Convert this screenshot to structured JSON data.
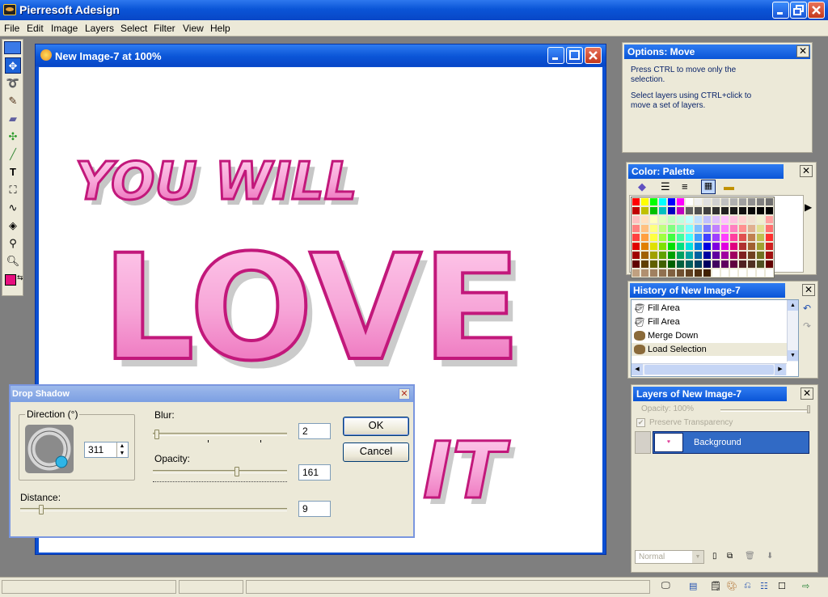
{
  "app": {
    "title": "Pierresoft Adesign"
  },
  "menu": [
    "File",
    "Edit",
    "Image",
    "Layers",
    "Select",
    "Filter",
    "View",
    "Help"
  ],
  "toolbox": {
    "tools": [
      "move-tool",
      "lasso-tool",
      "brush-tool",
      "eraser-tool",
      "transform-tool",
      "line-tool",
      "text-tool",
      "crop-tool",
      "shape-tool",
      "fill-tool",
      "eyedropper-tool",
      "zoom-tool"
    ],
    "foreground_color": "#e60f7e",
    "background_color": "#ffffff"
  },
  "document": {
    "title": "New Image-7 at 100%",
    "artwork_text": [
      "YOU WILL",
      "LOVE",
      "IT"
    ],
    "artwork_color": "#f06ab8"
  },
  "dialog": {
    "title": "Drop Shadow",
    "direction_label": "Direction (°)",
    "direction_value": "311",
    "blur_label": "Blur:",
    "blur_value": "2",
    "opacity_label": "Opacity:",
    "opacity_value": "161",
    "distance_label": "Distance:",
    "distance_value": "9",
    "ok_label": "OK",
    "cancel_label": "Cancel",
    "blur_slider_fraction": 0.01,
    "opacity_slider_fraction": 0.63,
    "distance_slider_fraction": 0.07
  },
  "options_panel": {
    "title": "Options: Move",
    "note1": "Press CTRL to move only the selection.",
    "note2": "Select layers using CTRL+click to move a set of layers."
  },
  "palette_panel": {
    "title": "Color: Palette",
    "colors": [
      "#ff0000",
      "#ffff00",
      "#00ff00",
      "#00ffff",
      "#0000ff",
      "#ff00ff",
      "#ffffff",
      "#f0f0f0",
      "#e0e0e0",
      "#d0d0d0",
      "#c0c0c0",
      "#b0b0b0",
      "#a0a0a0",
      "#909090",
      "#808080",
      "#707070",
      "#c00000",
      "#c0c000",
      "#00c000",
      "#00c0c0",
      "#0000c0",
      "#c000c0",
      "#606060",
      "#505050",
      "#404040",
      "#303030",
      "#202020",
      "#181818",
      "#101010",
      "#080808",
      "#040404",
      "#000000",
      "#ffc0c0",
      "#ffe0c0",
      "#ffffc0",
      "#e0ffc0",
      "#c0ffc0",
      "#c0ffe0",
      "#c0ffff",
      "#c0e0ff",
      "#c0c0ff",
      "#e0c0ff",
      "#ffc0ff",
      "#ffc0e0",
      "#ffd0d0",
      "#f0e0d0",
      "#f0f0d0",
      "#ffa0a0",
      "#ff8080",
      "#ffc080",
      "#ffff80",
      "#c0ff80",
      "#80ff80",
      "#80ffc0",
      "#80ffff",
      "#80c0ff",
      "#8080ff",
      "#c080ff",
      "#ff80ff",
      "#ff80c0",
      "#ff9090",
      "#e0b090",
      "#e0e090",
      "#ff7070",
      "#ff4040",
      "#ffa040",
      "#ffff40",
      "#a0ff40",
      "#40ff40",
      "#40ffa0",
      "#40ffff",
      "#40a0ff",
      "#4040ff",
      "#a040ff",
      "#ff40ff",
      "#ff40a0",
      "#e05050",
      "#c08050",
      "#c0c050",
      "#ff3030",
      "#e00000",
      "#e08000",
      "#e0e000",
      "#80e000",
      "#00e000",
      "#00e080",
      "#00e0e0",
      "#0080e0",
      "#0000e0",
      "#8000e0",
      "#e000e0",
      "#e00080",
      "#b03030",
      "#a06030",
      "#a0a030",
      "#d02020",
      "#a00000",
      "#a06000",
      "#a0a000",
      "#60a000",
      "#00a000",
      "#00a060",
      "#00a0a0",
      "#0060a0",
      "#0000a0",
      "#6000a0",
      "#a000a0",
      "#a00060",
      "#802020",
      "#704020",
      "#707020",
      "#a01010",
      "#600000",
      "#604000",
      "#606000",
      "#406000",
      "#006000",
      "#006040",
      "#006060",
      "#004060",
      "#000060",
      "#400060",
      "#600060",
      "#600040",
      "#502020",
      "#503020",
      "#505020",
      "#600000",
      "#c0a080",
      "#b09070",
      "#a08060",
      "#907050",
      "#806040",
      "#705030",
      "#604020",
      "#503010",
      "#402000",
      "#ffffff",
      "#ffffff",
      "#ffffff",
      "#ffffff",
      "#ffffff",
      "#ffffff",
      "#ffffff"
    ]
  },
  "history_panel": {
    "title": "History of New Image-7",
    "items": [
      "Fill Area",
      "Fill Area",
      "Merge Down",
      "Load Selection"
    ]
  },
  "layers_panel": {
    "title": "Layers of New Image-7",
    "opacity_label": "Opacity: 100%",
    "preserve_label": "Preserve Transparency",
    "layer_name": "Background",
    "blend_mode": "Normal"
  }
}
